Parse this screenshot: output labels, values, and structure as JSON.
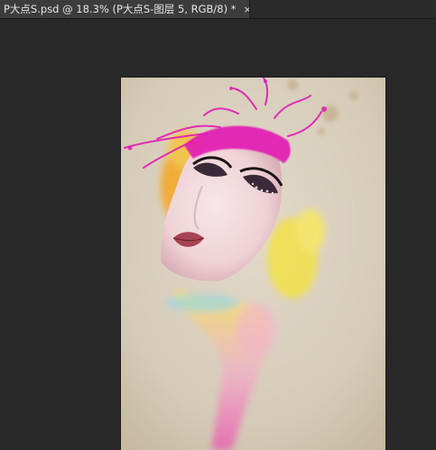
{
  "document_tab": {
    "title": "P大点S.psd @ 18.3% (P大点S-图层 5, RGB/8) *",
    "close_glyph": "×"
  },
  "canvas": {
    "description_icon": "artwork-image",
    "paper_color": "#d9cfbf",
    "accent_colors": [
      "#e21bb4",
      "#f2b43a",
      "#f0e040",
      "#7ecff0"
    ]
  }
}
